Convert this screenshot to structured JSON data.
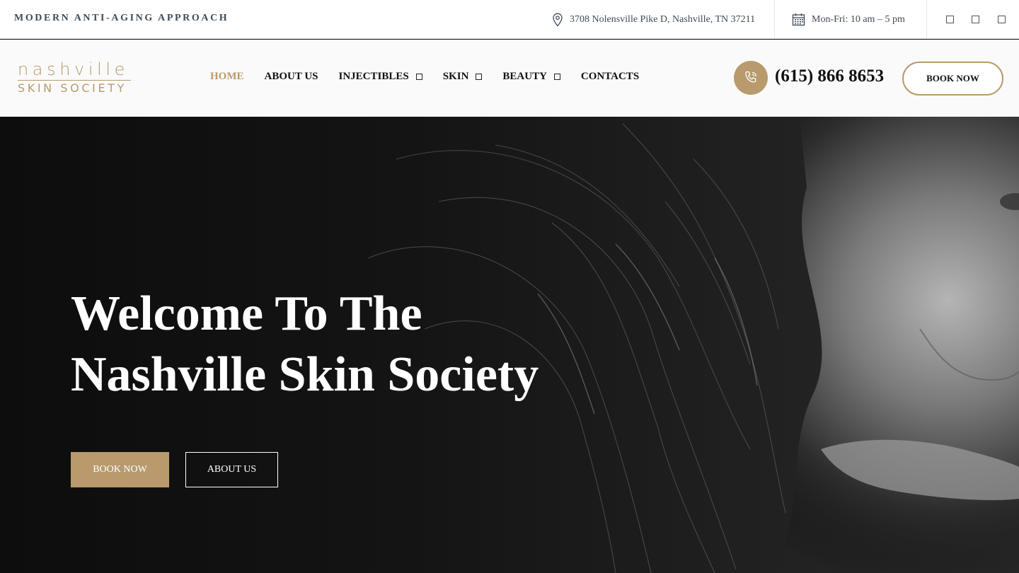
{
  "topbar": {
    "tagline": "MODERN ANTI-AGING APPROACH",
    "address": "3708 Nolensville Pike D, Nashville, TN 37211",
    "address_icon": "location-pin-icon",
    "hours": "Mon-Fri: 10 am – 5 pm",
    "hours_icon": "calendar-icon",
    "social_icons": [
      "social-icon-1",
      "social-icon-2",
      "social-icon-3"
    ]
  },
  "header": {
    "logo_top": "nashville",
    "logo_bottom": "SKIN SOCIETY",
    "nav": [
      {
        "label": "HOME",
        "active": true,
        "dropdown": false
      },
      {
        "label": "ABOUT US",
        "active": false,
        "dropdown": false
      },
      {
        "label": "INJECTIBLES",
        "active": false,
        "dropdown": true
      },
      {
        "label": "SKIN",
        "active": false,
        "dropdown": true
      },
      {
        "label": "BEAUTY",
        "active": false,
        "dropdown": true
      },
      {
        "label": "CONTACTS",
        "active": false,
        "dropdown": false
      }
    ],
    "phone_icon": "phone-icon",
    "phone": "(615) 866 8653",
    "book_label": "BOOK NOW"
  },
  "hero": {
    "title_line1": "Welcome To The",
    "title_line2": "Nashville Skin Society",
    "book_label": "BOOK NOW",
    "about_label": "ABOUT US"
  },
  "colors": {
    "accent": "#b89a6c",
    "text_dark": "#111111",
    "topbar_text": "#3f4a56",
    "hero_bg": "#0d0d0d"
  }
}
